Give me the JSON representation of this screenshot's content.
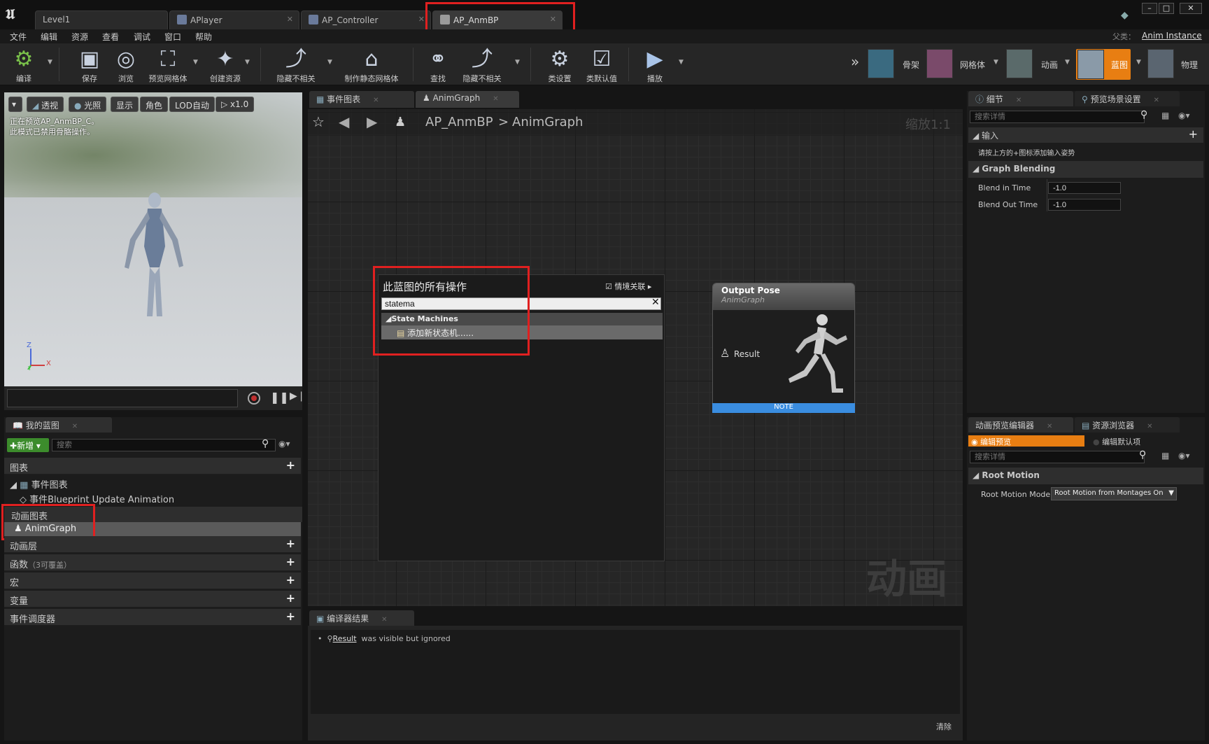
{
  "tabs": [
    {
      "label": "Level1"
    },
    {
      "label": "APlayer"
    },
    {
      "label": "AP_Controller"
    },
    {
      "label": "AP_AnmBP"
    }
  ],
  "parent_class": {
    "label": "父类：",
    "value": "Anim Instance"
  },
  "menu": [
    "文件",
    "编辑",
    "资源",
    "查看",
    "调试",
    "窗口",
    "帮助"
  ],
  "toolbar": {
    "compile": "编译",
    "save": "保存",
    "browse": "浏览",
    "preview_mesh": "预览网格体",
    "create_asset": "创建资源",
    "hide_unrelated": "隐藏不相关",
    "make_static_mesh": "制作静态网格体",
    "find": "查找",
    "hide_unrelated2": "隐藏不相关",
    "class_settings": "类设置",
    "class_defaults": "类默认值",
    "play": "播放"
  },
  "modes": {
    "skeleton": "骨架",
    "mesh": "网格体",
    "animation": "动画",
    "blueprint": "蓝图",
    "physics": "物理"
  },
  "viewport": {
    "buttons": [
      "透视",
      "光照",
      "显示",
      "角色",
      "LOD自动",
      "x1.0"
    ],
    "info_line1": "正在预览AP_AnmBP_C。",
    "info_line2": "此模式已禁用骨骼操作。",
    "axis_z": "Z",
    "axis_x": "X",
    "axis_y": "Y"
  },
  "my_blueprint": {
    "tab": "我的蓝图",
    "new_button": "新增",
    "search_placeholder": "搜索",
    "graphs": "图表",
    "event_graph": "事件图表",
    "event_item": "事件Blueprint Update Animation",
    "anim_graphs": "动画图表",
    "anim_graph_item": "AnimGraph",
    "anim_layers": "动画层",
    "functions": "函数",
    "functions_note": "（3可覆盖）",
    "macros": "宏",
    "variables": "变量",
    "event_dispatchers": "事件调度器"
  },
  "graph_editor": {
    "tab_event": "事件图表",
    "tab_anim": "AnimGraph",
    "breadcrumb_bp": "AP_AnmBP",
    "breadcrumb_sep": ">",
    "breadcrumb_graph": "AnimGraph",
    "zoom": "缩放1:1",
    "watermark": "动画"
  },
  "context_menu": {
    "title": "此蓝图的所有操作",
    "context_label": "情境关联",
    "search_value": "statema",
    "category": "State Machines",
    "item": "添加新状态机......"
  },
  "output_pose": {
    "title": "Output Pose",
    "subtitle": "AnimGraph",
    "pin": "Result",
    "note": "NOTE"
  },
  "compiler": {
    "tab": "编译器结果",
    "message_link": "Result",
    "message_rest": "was visible but ignored",
    "clear": "清除"
  },
  "details": {
    "tab": "细节",
    "tab2": "预览场景设置",
    "search_placeholder": "搜索详情",
    "inputs": "输入",
    "inputs_hint": "请按上方的+图标添加输入姿势",
    "blending": "Graph Blending",
    "blend_in_label": "Blend in Time",
    "blend_in_value": "-1.0",
    "blend_out_label": "Blend Out Time",
    "blend_out_value": "-1.0"
  },
  "preview_editor": {
    "tab": "动画预览编辑器",
    "tab2": "资源浏览器",
    "edit_preview": "编辑预览",
    "edit_defaults": "编辑默认项",
    "search_placeholder": "搜索详情",
    "root_motion": "Root Motion",
    "root_motion_mode_label": "Root Motion Mode",
    "root_motion_mode_value": "Root Motion from Montages On"
  },
  "colors": {
    "accent_orange": "#e87e12",
    "note_blue": "#3a8de0",
    "highlight_red": "#e02020",
    "new_green": "#3c8c2c"
  }
}
